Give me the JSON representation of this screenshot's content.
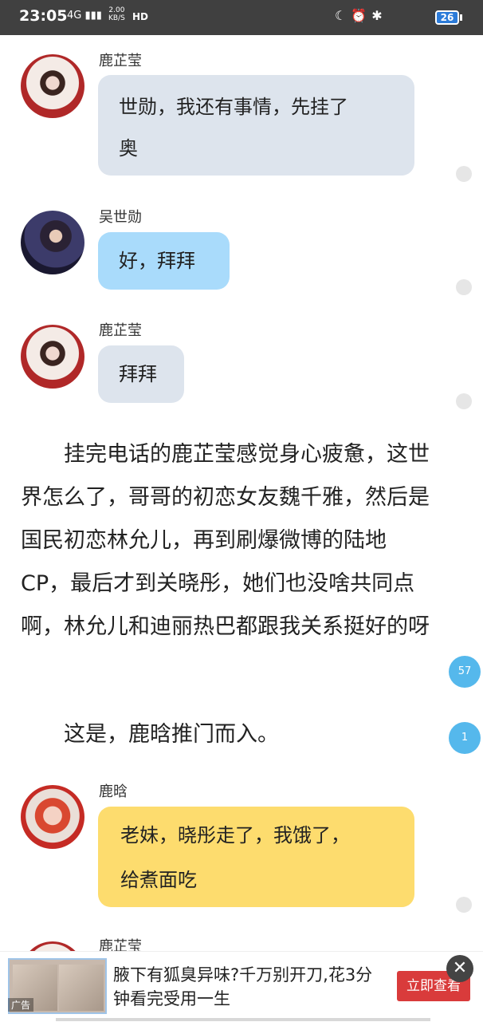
{
  "status_bar": {
    "time": "23:05",
    "network": "4G",
    "speed_value": "2.00",
    "speed_unit": "KB/S",
    "hd": "HD",
    "battery": "26"
  },
  "messages": [
    {
      "sender": "鹿芷莹",
      "lines": [
        "世勋，我还有事情，先挂了",
        "奥"
      ]
    },
    {
      "sender": "吴世勋",
      "lines": [
        "好，拜拜"
      ]
    },
    {
      "sender": "鹿芷莹",
      "lines": [
        "拜拜"
      ]
    },
    {
      "sender": "鹿晗",
      "lines": [
        "老妹，晓彤走了，我饿了，",
        "给煮面吃"
      ]
    },
    {
      "sender": "鹿芷莹"
    }
  ],
  "narration": {
    "para1": "挂完电话的鹿芷莹感觉身心疲惫，这世界怎么了，哥哥的初恋女友魏千雅，然后是国民初恋林允儿，再到刷爆微博的陆地CP，最后才到关晓彤，她们也没啥共同点啊，林允儿和迪丽热巴都跟我关系挺好的呀",
    "para2": "这是，鹿晗推门而入。"
  },
  "comment_counts": {
    "para1": "57",
    "para2": "1"
  },
  "ad": {
    "tag": "广告",
    "text": "腋下有狐臭异味?千万别开刀,花3分钟看完受用一生",
    "cta": "立即查看",
    "close": "✕"
  },
  "colors": {
    "bubble_gray": "#dde4ed",
    "bubble_blue": "#a9dbfb",
    "bubble_yellow": "#fddc6e",
    "count_badge": "#55b8ec",
    "ad_button": "#d93b3b"
  }
}
